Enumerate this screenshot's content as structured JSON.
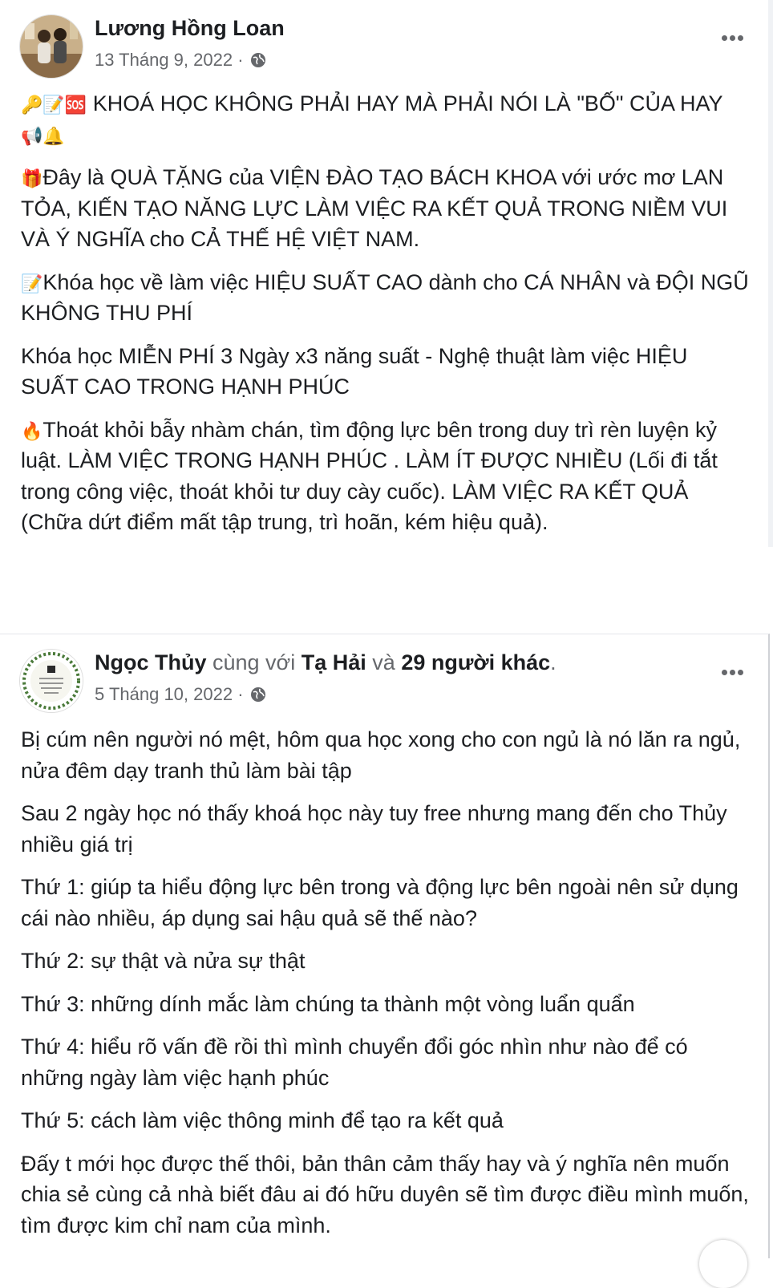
{
  "post1": {
    "author": "Lương Hồng Loan",
    "date": "13 Tháng 9, 2022 ·",
    "privacy_icon": "globe-icon",
    "paragraphs": [
      {
        "emoji": "🔑📝🆘",
        "text": " KHOÁ HỌC KHÔNG PHẢI HAY MÀ PHẢI NÓI LÀ \"BỐ\" CỦA HAY ",
        "trail": "📢🔔"
      },
      {
        "emoji": "🎁",
        "text": "Đây là QUÀ TẶNG của VIỆN ĐÀO TẠO BÁCH KHOA với ước mơ LAN TỎA, KIẾN TẠO NĂNG LỰC LÀM VIỆC RA KẾT QUẢ TRONG NIỀM VUI VÀ Ý NGHĨA cho CẢ THẾ HỆ VIỆT NAM."
      },
      {
        "emoji": "📝",
        "text": "Khóa học về làm việc HIỆU SUẤT CAO dành cho CÁ NHÂN và ĐỘI NGŨ KHÔNG THU PHÍ"
      },
      {
        "emoji": "",
        "text": "Khóa học MIỄN PHÍ 3 Ngày x3 năng suất - Nghệ thuật làm việc HIỆU SUẤT CAO TRONG HẠNH PHÚC"
      },
      {
        "emoji": "🔥",
        "text": "Thoát khỏi bẫy nhàm chán, tìm động lực bên trong duy trì rèn luyện kỷ luật. LÀM VIỆC TRONG HẠNH PHÚC . LÀM ÍT ĐƯỢC NHIỀU (Lối đi tắt trong công việc, thoát khỏi tư duy cày cuốc). LÀM VIỆC RA KẾT QUẢ (Chữa dứt điểm mất tập trung, trì hoãn, kém hiệu quả)."
      }
    ]
  },
  "post2": {
    "author": "Ngọc Thủy",
    "with_text": " cùng với ",
    "tagged": "Tạ Hải",
    "and_text": " và ",
    "others": "29 người khác",
    "period": ".",
    "date": "5 Tháng 10, 2022 ·",
    "privacy_icon": "globe-icon",
    "paragraphs": [
      "Bị cúm nên người nó mệt, hôm qua học xong cho con ngủ là nó lăn ra ngủ, nửa đêm dạy tranh thủ làm bài tập",
      "Sau 2 ngày học nó thấy khoá học này tuy free nhưng mang đến cho Thủy nhiều giá trị",
      "Thứ 1: giúp ta hiểu động lực bên trong và động lực bên ngoài nên sử dụng cái nào nhiều, áp dụng sai hậu quả sẽ thế nào?",
      "Thứ 2: sự thật và nửa sự thật",
      "Thứ 3: những dính mắc làm chúng ta thành một vòng luẩn quẩn",
      "Thứ 4: hiểu rõ vấn đề rồi thì mình chuyển đổi góc nhìn như nào để có những ngày làm việc hạnh phúc",
      "Thứ 5: cách làm việc thông minh để tạo ra kết quả",
      "Đấy t mới học được thế thôi, bản thân cảm thấy hay và ý nghĩa nên muốn chia sẻ cùng cả nhà biết đâu ai đó hữu duyên sẽ tìm được điều mình muốn, tìm được kim chỉ nam của mình."
    ]
  },
  "colors": {
    "text": "#1c1e21",
    "muted": "#65676b"
  }
}
